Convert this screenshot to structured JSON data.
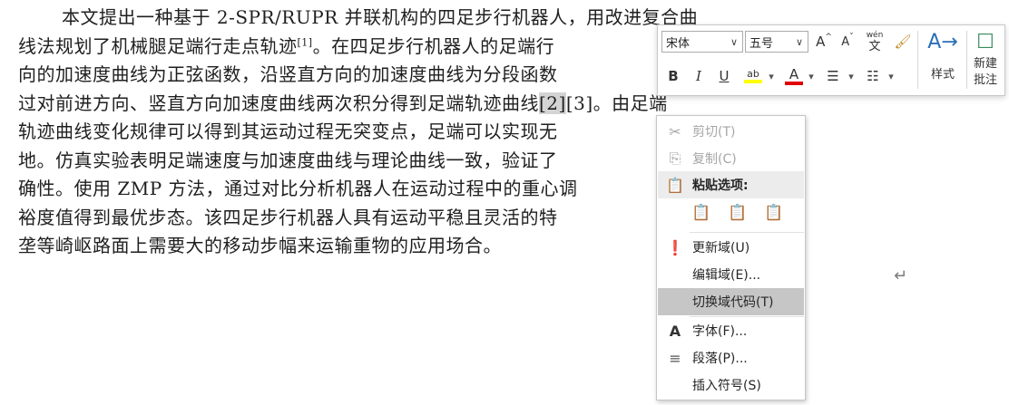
{
  "document": {
    "line1": "本文提出一种基于 2-SPR/RUPR 并联机构的四足步行机器人，用改进复合曲",
    "line2_pre": "线法规划了机械腿足端行走点轨迹",
    "line2_sup": "[1]",
    "line2_post": "。在四足步行机器人的足端行",
    "line3": "向的加速度曲线为正弦函数，沿竖直方向的加速度曲线为分段函数",
    "line4_pre": "过对前进方向、竖直方向加速度曲线两次积分得到足端轨迹曲线",
    "line4_field": "[2]",
    "line4_post": "[3]。由足端",
    "line5": "轨迹曲线变化规律可以得到其运动过程无突变点，足端可以实现无",
    "line6": "地。仿真实验表明足端速度与加速度曲线与理论曲线一致，验证了",
    "line7": "确性。使用 ZMP 方法，通过对比分析机器人在运动过程中的重心调",
    "line8": "裕度值得到最优步态。该四足步行机器人具有运动平稳且灵活的特",
    "line9": "垄等崎岖路面上需要大的移动步幅来运输重物的应用场合。",
    "paragraph_mark": "↵"
  },
  "mini_toolbar": {
    "font_name": "宋体",
    "font_size": "五号",
    "grow_font": "A",
    "shrink_font": "A",
    "phonetic_top": "wén",
    "phonetic_bottom": "文",
    "bold": "B",
    "italic": "I",
    "underline": "U",
    "highlight": "ab",
    "font_color": "A",
    "styles_label": "样式",
    "new_comment_label_1": "新建",
    "new_comment_label_2": "批注"
  },
  "context_menu": {
    "cut": "剪切(T)",
    "copy": "复制(C)",
    "paste_options": "粘贴选项:",
    "update_field": "更新域(U)",
    "edit_field": "编辑域(E)...",
    "toggle_field_codes": "切换域代码(T)",
    "font": "字体(F)...",
    "paragraph": "段落(P)...",
    "insert_symbol": "插入符号(S)"
  }
}
